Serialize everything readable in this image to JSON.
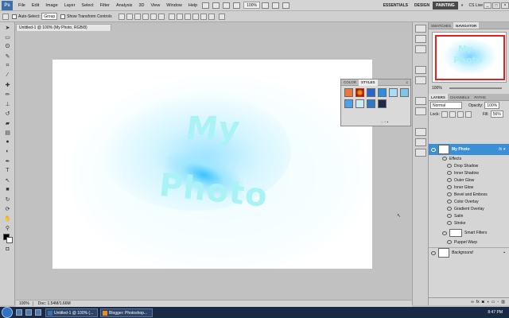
{
  "app": {
    "logo": "Ps"
  },
  "menu": [
    "File",
    "Edit",
    "Image",
    "Layer",
    "Select",
    "Filter",
    "Analysis",
    "3D",
    "View",
    "Window",
    "Help"
  ],
  "topbar": {
    "zoom": "100%",
    "workspaces": [
      "ESSENTIALS",
      "DESIGN",
      "PAINTING"
    ],
    "active_workspace": "PAINTING",
    "cslive": "CS Live"
  },
  "options": {
    "auto_select_label": "Auto-Select:",
    "auto_select_value": "Group",
    "show_transform_label": "Show Transform Controls"
  },
  "document": {
    "tab_title": "Untitled-1 @ 100% (My Photo, RGB/8)",
    "text_line1": "My",
    "text_line2": "Photo"
  },
  "status": {
    "zoom": "100%",
    "doc": "Doc: 1.54M/1.66M"
  },
  "styles_panel": {
    "tabs": [
      "COLOR",
      "STYLES"
    ],
    "active_tab": "STYLES"
  },
  "navigator": {
    "tabs": [
      "SWATCHES",
      "NAVIGATOR"
    ],
    "active_tab": "NAVIGATOR",
    "zoom": "100%"
  },
  "layers": {
    "tabs": [
      "LAYERS",
      "CHANNELS",
      "PATHS"
    ],
    "active_tab": "LAYERS",
    "blend_mode": "Normal",
    "opacity_label": "Opacity:",
    "opacity": "100%",
    "lock_label": "Lock:",
    "fill_label": "Fill:",
    "fill": "56%",
    "selected_layer": "My Photo",
    "effects_label": "Effects",
    "effects": [
      "Drop Shadow",
      "Inner Shadow",
      "Outer Glow",
      "Inner Glow",
      "Bevel and Emboss",
      "Color Overlay",
      "Gradient Overlay",
      "Satin",
      "Stroke"
    ],
    "smart_filters": "Smart Filters",
    "filter": "Puppet Warp",
    "background": "Background"
  },
  "taskbar": {
    "buttons": [
      "Untitled-1 @ 100% (...",
      "Blogger: Photoshop..."
    ],
    "clock": "8:47 PM"
  },
  "colors": {
    "selected": "#3a8fd6",
    "accent_text": "#a9f2f6",
    "nav_box": "#e62020"
  }
}
